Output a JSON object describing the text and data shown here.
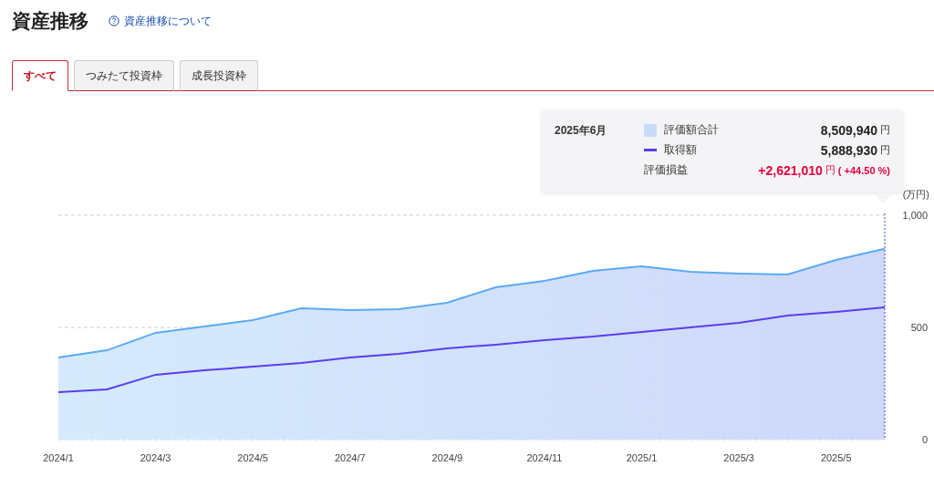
{
  "title": "資産推移",
  "help_link": {
    "label": "資産推移について"
  },
  "tabs": [
    {
      "label": "すべて",
      "selected": true
    },
    {
      "label": "つみたて投資枠",
      "selected": false
    },
    {
      "label": "成長投資枠",
      "selected": false
    }
  ],
  "tooltip": {
    "date": "2025年6月",
    "series_values": [
      {
        "value": "8,509,940",
        "unit": "円"
      },
      {
        "value": "5,888,930",
        "unit": "円"
      }
    ],
    "profit": {
      "label": "評価損益",
      "value": "+2,621,010",
      "unit": "円",
      "extra": "( +44.50 %)"
    }
  },
  "chart_data": {
    "type": "area",
    "ylabel": "(万円)",
    "categories": [
      "2024/1",
      null,
      "2024/3",
      null,
      "2024/5",
      null,
      "2024/7",
      null,
      "2024/9",
      null,
      "2024/11",
      null,
      "2025/1",
      null,
      "2025/3",
      null,
      "2025/5",
      null
    ],
    "ylim": [
      0,
      1000
    ],
    "yticks": [
      {
        "value": 0,
        "label": "0"
      },
      {
        "value": 500,
        "label": "500"
      },
      {
        "value": 1000,
        "label": "1,000"
      }
    ],
    "series": [
      {
        "name": "評価額合計",
        "type": "area",
        "color": "#5aaaf5",
        "values": [
          366,
          398,
          476,
          504,
          533,
          585,
          577,
          581,
          610,
          679,
          707,
          752,
          772,
          748,
          740,
          736,
          801,
          851
        ]
      },
      {
        "name": "取得額",
        "type": "line",
        "color": "#5b3cf0",
        "values": [
          211,
          224,
          289,
          309,
          325,
          341,
          366,
          382,
          407,
          423,
          443,
          459,
          480,
          500,
          520,
          553,
          569,
          589
        ]
      }
    ]
  }
}
